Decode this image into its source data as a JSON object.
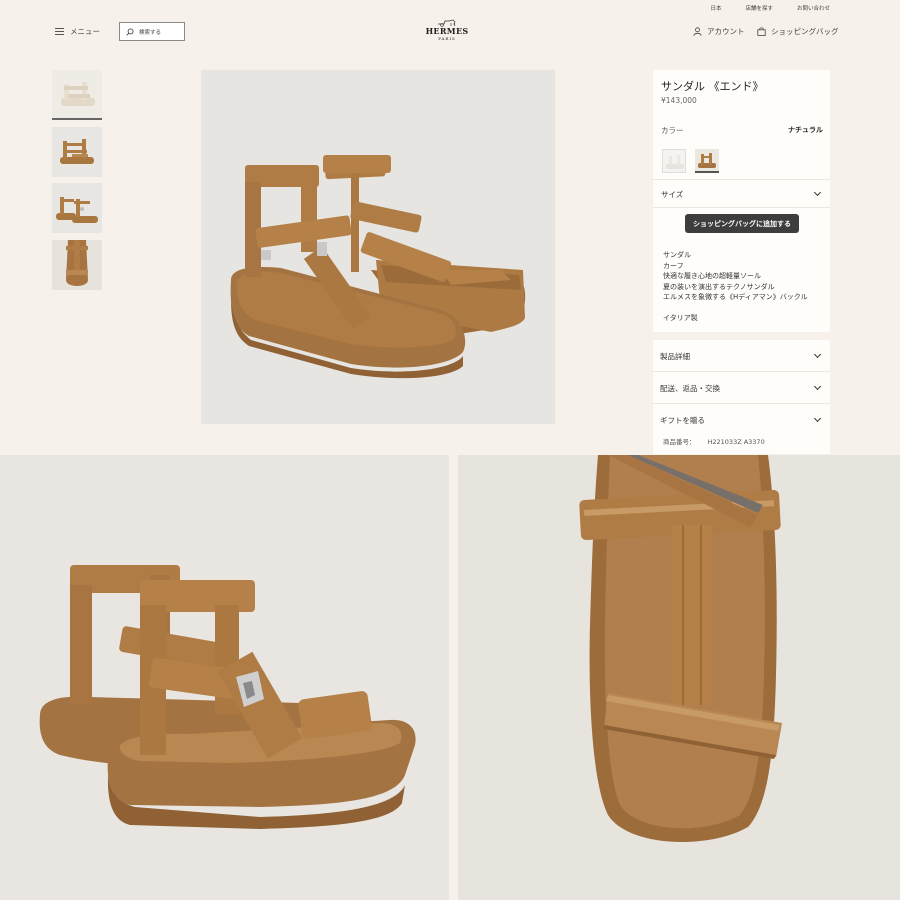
{
  "utility_nav": [
    "日本",
    "店舗を探す",
    "お問い合わせ"
  ],
  "header": {
    "menu_label": "メニュー",
    "search_placeholder": "検索する",
    "brand": "HERMES",
    "brand_sub": "PARIS",
    "account_label": "アカウント",
    "bag_label": "ショッピングバッグ"
  },
  "product": {
    "title": "サンダル 《エンド》",
    "price": "¥143,000",
    "color_label": "カラー",
    "color_value": "ナチュラル",
    "size_label": "サイズ",
    "add_to_bag": "ショッピングバッグに追加する",
    "description": [
      "サンダル",
      "カーフ",
      "快適な履き心地の超軽量ソール",
      "夏の装いを演出するテクノサンダル",
      "エルメスを象徴する《Hディアマン》バックル"
    ],
    "origin": "イタリア製",
    "accordions": [
      "製品詳細",
      "配送、返品・交換",
      "ギフトを贈る"
    ],
    "ref_label": "商品番号：",
    "ref_value": "H221033Z A3370"
  },
  "colors": {
    "leather": "#b07c45",
    "sole": "#a77441",
    "background": "#f6f1eb",
    "button": "#3d3d3d"
  }
}
